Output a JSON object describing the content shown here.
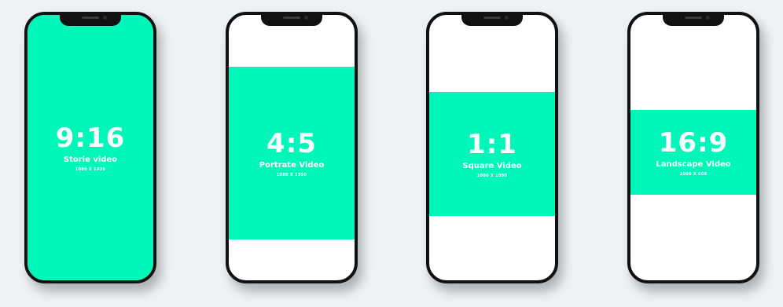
{
  "phones": [
    {
      "ratio": "9:16",
      "name": "Storie video",
      "resolution": "1080 X 1920"
    },
    {
      "ratio": "4:5",
      "name": "Portrate Video",
      "resolution": "1080 X 1350"
    },
    {
      "ratio": "1:1",
      "name": "Square Video",
      "resolution": "1080 X 1080"
    },
    {
      "ratio": "16:9",
      "name": "Landscape Video",
      "resolution": "1080 X 608"
    }
  ],
  "colors": {
    "video_area": "#00f7b9",
    "phone_frame": "#111111",
    "background": "#eef2f5"
  }
}
